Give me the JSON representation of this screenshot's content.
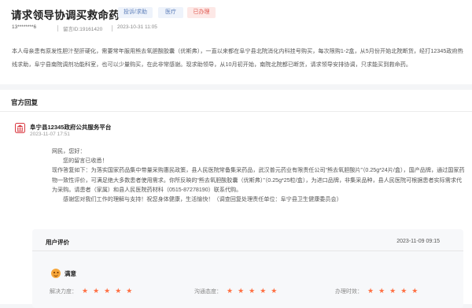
{
  "question": {
    "title": "请求领导协调买救命药",
    "tags": [
      "投诉/求助",
      "医疗",
      "已办理"
    ],
    "user": "13********6",
    "message_id": "留言ID:19161420",
    "time": "2023-10-31 11:05",
    "body": "本人母亲患有原发性胆汁型肝硬化，需要常年服用熊去氧胆酸胶囊（优斯弗），一直以来都在阜宁县北院消化内科挂号购买，每次限购1-2盒，从5月份开始北院断货，经打12345政府热线求助，阜宁县南院调剂功能科室，也可以少量购买，在此非常感谢。现求助领导，从10月初开始，南院北院都已断货，请求领导安排协调，只求能买到救命药。"
  },
  "reply": {
    "heading": "官方回复",
    "org": "阜宁县12345政府公共服务平台",
    "time": "2023-11-07 17:51",
    "greeting": "网民，您好：",
    "received": "您的留言已收悉！",
    "body": "现作答复如下：为落实国家药品集中带量采购惠民政策，县人民医院常备集采药品，武汉普元药业有限责任公司“熊去氧胆酸片”（0.25g*24片/盒），国产品牌，通过国家药物一致性评价，可满足绝大多数患者使用需求。你所反映的“熊去氧胆酸胶囊（优斯弗）”（0.25g*25粒/盒），为进口品牌，非集采品种，县人民医院可根据患者实际需求代为采购。请患者（家属）和县人民医院药材科（0515-87278190）联系代购。",
    "closing": "感谢您对我们工作的理解与支持！祝您身体健康，生活愉快！（调查回复处理责任单位：阜宁县卫生健康委员会）"
  },
  "evaluation": {
    "heading": "用户评价",
    "date": "2023-11-09 09:15",
    "satisfaction": "满意",
    "ratings": [
      {
        "label": "解决力度：",
        "stars": "★★★★★",
        "score": 5
      },
      {
        "label": "沟通态度：",
        "stars": "★★★★★",
        "score": 5
      },
      {
        "label": "办理时效：",
        "stars": "★★★★★",
        "score": 5
      }
    ]
  }
}
